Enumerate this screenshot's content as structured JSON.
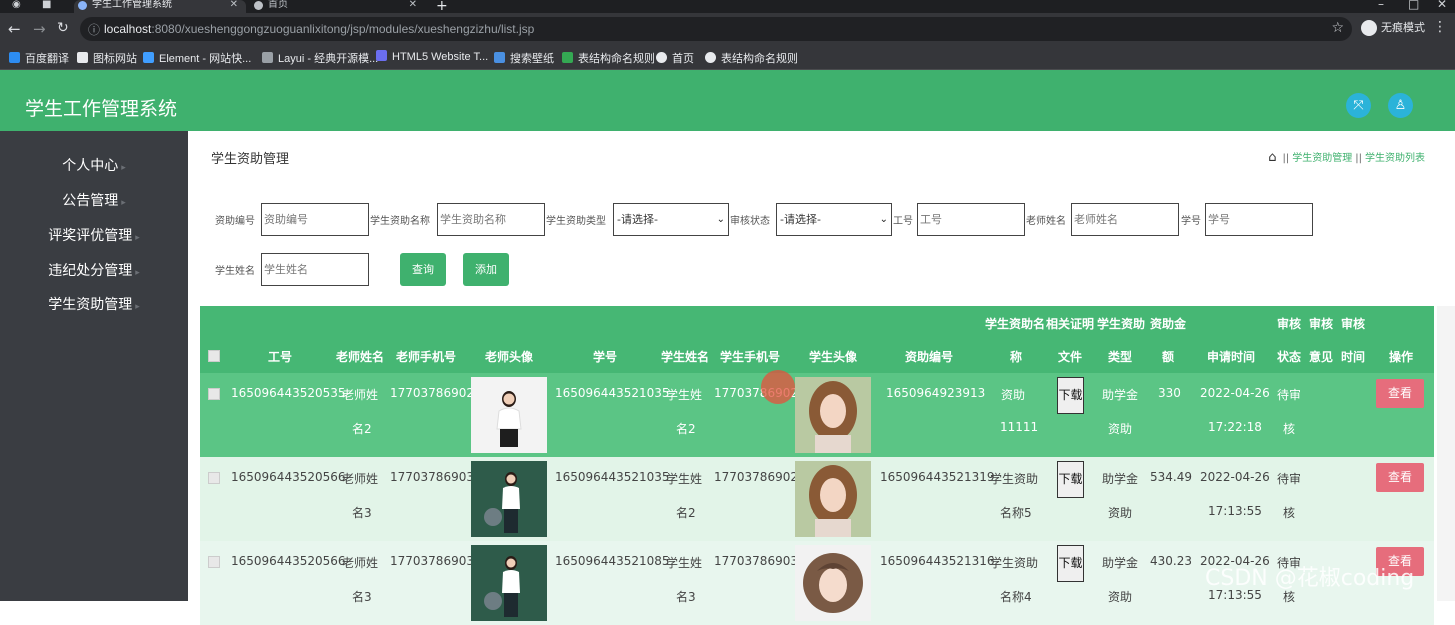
{
  "browser": {
    "tabs": [
      {
        "title": "学生工作管理系统"
      },
      {
        "title": "首页"
      }
    ],
    "url_host": "localhost",
    "url_path": ":8080/xueshenggongzuoguanlixitong/jsp/modules/xueshengzizhu/list.jsp",
    "incognito_label": "无痕模式",
    "bookmarks": [
      {
        "label": "百度翻译"
      },
      {
        "label": "图标网站"
      },
      {
        "label": "Element - 网站快..."
      },
      {
        "label": "Layui - 经典开源模..."
      },
      {
        "label": "HTML5 Website T..."
      },
      {
        "label": "搜索壁纸"
      },
      {
        "label": "表结构命名规则"
      },
      {
        "label": "首页"
      },
      {
        "label": "表结构命名规则"
      }
    ]
  },
  "app": {
    "title": "学生工作管理系统"
  },
  "sidebar": {
    "items": [
      {
        "label": "个人中心"
      },
      {
        "label": "公告管理"
      },
      {
        "label": "评奖评优管理"
      },
      {
        "label": "违纪处分管理"
      },
      {
        "label": "学生资助管理"
      }
    ]
  },
  "main": {
    "heading": "学生资助管理",
    "breadcrumb": [
      "学生资助管理",
      "学生资助列表"
    ],
    "filters": {
      "aid_no_label": "资助编号",
      "aid_no_placeholder": "资助编号",
      "aid_name_label": "学生资助名称",
      "aid_name_placeholder": "学生资助名称",
      "aid_type_label": "学生资助类型",
      "aid_type_value": "-请选择-",
      "audit_label": "审核状态",
      "audit_value": "-请选择-",
      "job_no_label": "工号",
      "job_no_placeholder": "工号",
      "teacher_label": "老师姓名",
      "teacher_placeholder": "老师姓名",
      "student_no_label": "学号",
      "student_no_placeholder": "学号",
      "student_name_label": "学生姓名",
      "student_name_placeholder": "学生姓名",
      "query_label": "查询",
      "add_label": "添加"
    },
    "table": {
      "headers": {
        "job_no": "工号",
        "teacher_name": "老师姓名",
        "teacher_phone": "老师手机号",
        "teacher_avatar": "老师头像",
        "student_no": "学号",
        "student_name": "学生姓名",
        "student_phone": "学生手机号",
        "student_avatar": "学生头像",
        "aid_no": "资助编号",
        "aid_name_a": "学生资助名",
        "aid_name_b": "称",
        "proof_a": "相关证明",
        "proof_b": "文件",
        "aid_type_a": "学生资助",
        "aid_type_b": "类型",
        "amount_a": "资助金",
        "amount_b": "额",
        "apply_time": "申请时间",
        "audit_status_a": "审核",
        "audit_status_b": "状态",
        "audit_opinion_a": "审核",
        "audit_opinion_b": "意见",
        "audit_time_a": "审核",
        "audit_time_b": "时间",
        "action": "操作"
      },
      "rows": [
        {
          "job_no": "165096443520535",
          "teacher_name_a": "老师姓",
          "teacher_name_b": "名2",
          "teacher_phone": "17703786902",
          "student_no": "165096443521035",
          "student_name_a": "学生姓",
          "student_name_b": "名2",
          "student_phone": "17703786902",
          "aid_no": "1650964923913",
          "aid_name_a": "资助",
          "aid_name_b": "11111",
          "download": "下载",
          "aid_type_a": "助学金",
          "aid_type_b": "资助",
          "amount": "330",
          "apply_date": "2022-04-26",
          "apply_clock": "17:22:18",
          "audit_a": "待审",
          "audit_b": "核",
          "view": "查看"
        },
        {
          "job_no": "165096443520566",
          "teacher_name_a": "老师姓",
          "teacher_name_b": "名3",
          "teacher_phone": "17703786903",
          "student_no": "165096443521035",
          "student_name_a": "学生姓",
          "student_name_b": "名2",
          "student_phone": "17703786902",
          "aid_no": "165096443521319",
          "aid_name_a": "学生资助",
          "aid_name_b": "名称5",
          "download": "下载",
          "aid_type_a": "助学金",
          "aid_type_b": "资助",
          "amount": "534.49",
          "apply_date": "2022-04-26",
          "apply_clock": "17:13:55",
          "audit_a": "待审",
          "audit_b": "核",
          "view": "查看"
        },
        {
          "job_no": "165096443520566",
          "teacher_name_a": "老师姓",
          "teacher_name_b": "名3",
          "teacher_phone": "17703786903",
          "student_no": "165096443521085",
          "student_name_a": "学生姓",
          "student_name_b": "名3",
          "student_phone": "17703786903",
          "aid_no": "165096443521316",
          "aid_name_a": "学生资助",
          "aid_name_b": "名称4",
          "download": "下载",
          "aid_type_a": "助学金",
          "aid_type_b": "资助",
          "amount": "430.23",
          "apply_date": "2022-04-26",
          "apply_clock": "17:13:55",
          "audit_a": "待审",
          "audit_b": "核",
          "view": "查看"
        }
      ]
    }
  },
  "watermark": "CSDN @花椒coding",
  "colors": {
    "brand_green": "#3fb16e",
    "sidebar_bg": "#3a3d42",
    "view_button": "#e66d7c",
    "header_icon": "#2bb3d9"
  }
}
